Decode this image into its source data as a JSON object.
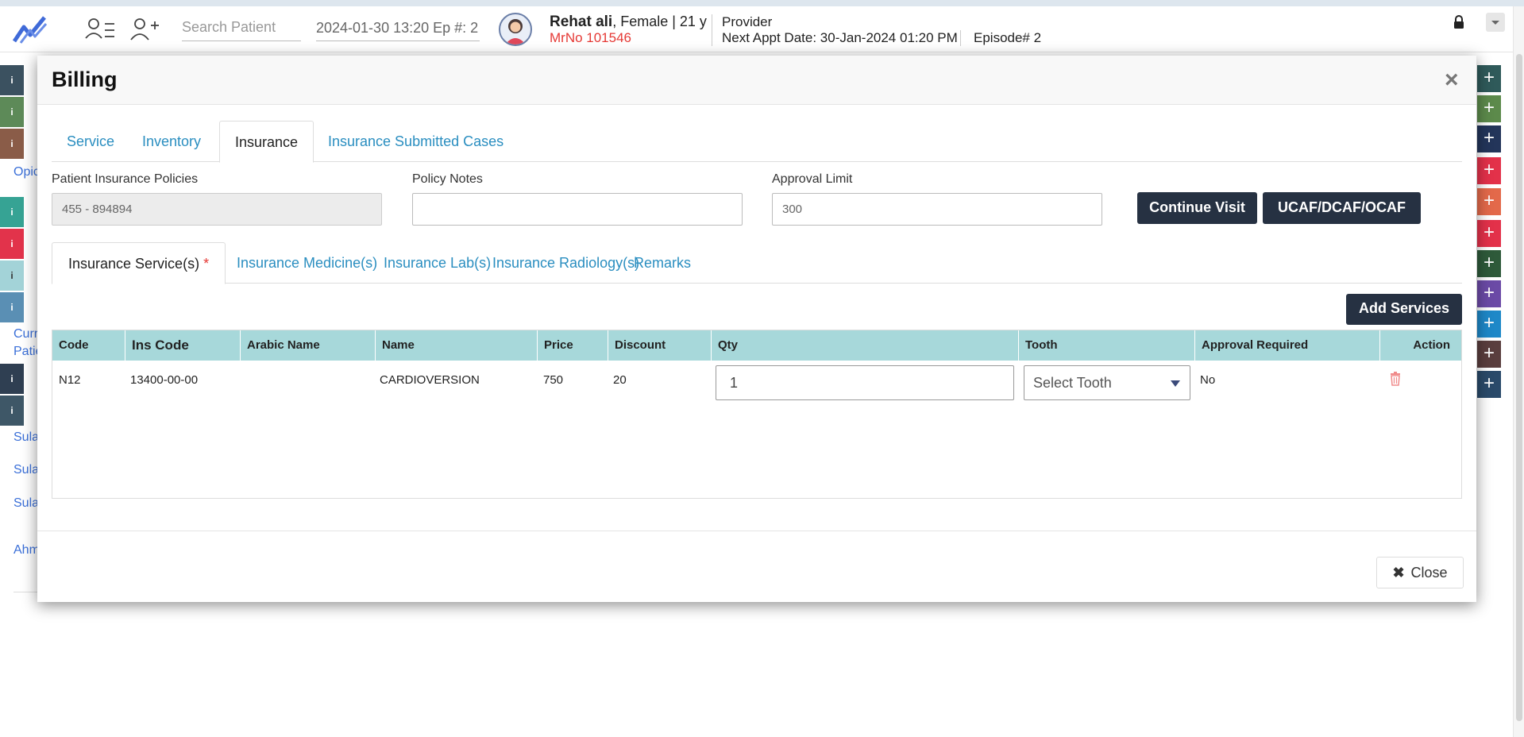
{
  "header": {
    "search_placeholder": "Search Patient",
    "episode_value": "2024-01-30 13:20 Ep #: 2",
    "patient_name": "Rehat ali",
    "patient_info": ", Female | 21 y",
    "mrno": "MrNo 101546",
    "provider": "Provider",
    "next_appt_label": "Next Appt Date:",
    "next_appt_value": " 30-Jan-2024 01:20 PM",
    "episode_no": "Episode# 2",
    "icons": [
      "chart-logo-icon",
      "patient-list-icon",
      "add-patient-icon",
      "lock-icon",
      "chevron-down-icon"
    ]
  },
  "background": {
    "left_links": [
      "Opic",
      "Curr",
      "Patie",
      "Sula",
      "Sula",
      "Sula",
      "Ahm"
    ],
    "left_colors": [
      "#3b5160",
      "#5d8a58",
      "#8a5c48",
      "#36a394",
      "#e2334b",
      "#a3d3d8",
      "#5a8fb4",
      "#2f3f52",
      "#3e5767"
    ],
    "right_colors": [
      "#2f5a5a",
      "#5c8a4b",
      "#23355a",
      "#e3314a",
      "#e3694a",
      "#e3314a",
      "#2e5a3a",
      "#6b4aa6",
      "#1e88c8",
      "#5a3e3e",
      "#2a4a6a"
    ],
    "right_glyph": "+",
    "info_glyph": "i"
  },
  "modal": {
    "title": "Billing",
    "close_x": "×",
    "tabs": [
      {
        "label": "Service"
      },
      {
        "label": "Inventory"
      },
      {
        "label": "Insurance"
      },
      {
        "label": "Insurance Submitted Cases"
      }
    ],
    "active_tab": "Insurance",
    "fields": {
      "policies_label": "Patient Insurance Policies",
      "policies_value": "455 - 894894",
      "notes_label": "Policy Notes",
      "notes_value": "",
      "limit_label": "Approval Limit",
      "limit_value": "300"
    },
    "buttons": {
      "continue_visit": "Continue Visit",
      "ucaf": "UCAF/DCAF/OCAF",
      "add_services": "Add Services",
      "close": "Close",
      "close_glyph": "✖"
    },
    "subtabs": [
      {
        "label": "Insurance Service(s)"
      },
      {
        "label": "Insurance Medicine(s)"
      },
      {
        "label": "Insurance Lab(s)"
      },
      {
        "label": "Insurance Radiology(s)"
      },
      {
        "label": "Remarks"
      }
    ],
    "required_mark": "*",
    "table": {
      "columns": [
        "Code",
        "Ins Code",
        "Arabic Name",
        "Name",
        "Price",
        "Discount",
        "Qty",
        "Tooth",
        "Approval Required",
        "Action"
      ],
      "rows": [
        {
          "code": "N12",
          "ins_code": "13400-00-00",
          "arabic_name": "",
          "name": "CARDIOVERSION",
          "price": "750",
          "discount": "20",
          "qty": "1",
          "tooth": "Select Tooth",
          "approval_required": "No"
        }
      ]
    }
  },
  "colors": {
    "accent_link": "#2a8ec0",
    "dark_button": "#263142",
    "table_header": "#a7d8da",
    "required": "#e53935",
    "mrno": "#e53935"
  }
}
